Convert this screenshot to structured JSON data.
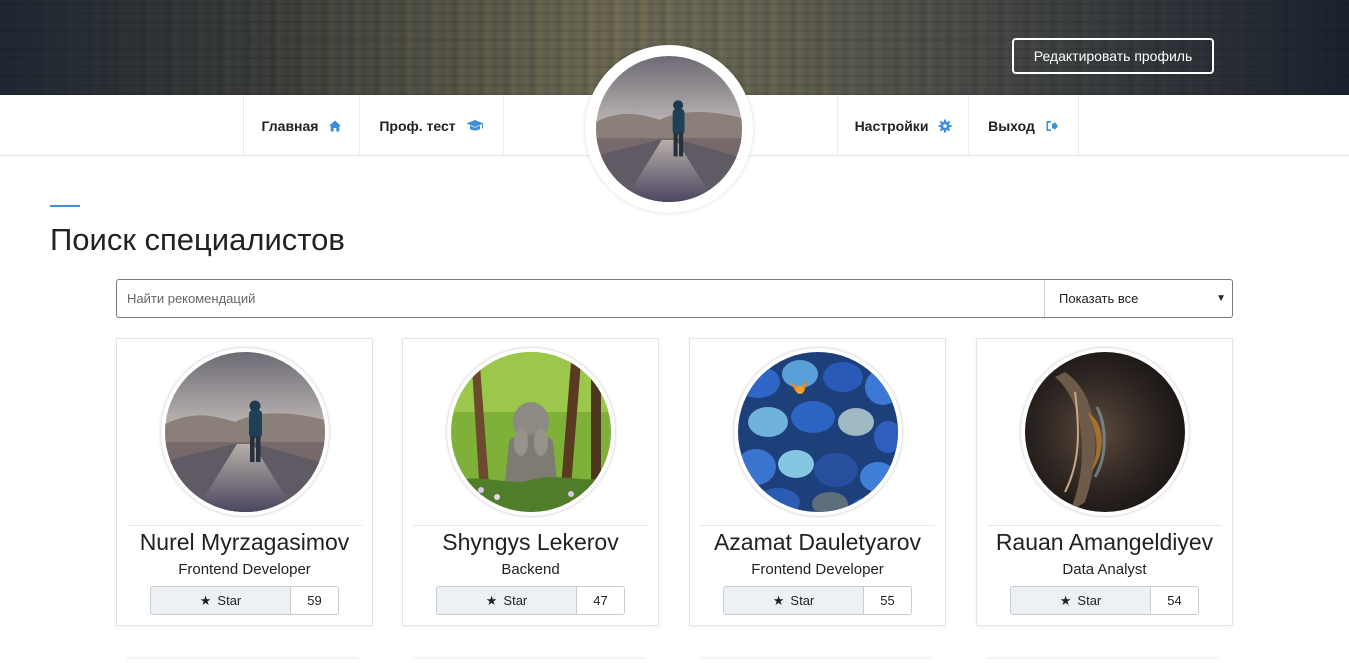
{
  "header": {
    "edit_profile_label": "Редактировать профиль"
  },
  "nav": {
    "items": [
      {
        "label": "Главная",
        "icon": "home-icon"
      },
      {
        "label": "Проф. тест",
        "icon": "graduation-cap-icon"
      },
      {
        "label": "Настройки",
        "icon": "gear-icon"
      },
      {
        "label": "Выход",
        "icon": "sign-out-icon"
      }
    ]
  },
  "profile": {
    "avatar": "road-walker-photo"
  },
  "page": {
    "title": "Поиск специалистов"
  },
  "search": {
    "placeholder": "Найти рекомендаций",
    "value": "",
    "filter_selected": "Показать все"
  },
  "colors": {
    "accent": "#3d8fd6",
    "star_button_bg": "#eef1f4"
  },
  "specialists": [
    {
      "name": "Nurel Myrzagasimov",
      "role": "Frontend Developer",
      "star_label": "Star",
      "stars": "59",
      "photo": "road-walker-photo"
    },
    {
      "name": "Shyngys Lekerov",
      "role": "Backend",
      "star_label": "Star",
      "stars": "47",
      "photo": "stone-statue-photo"
    },
    {
      "name": "Azamat Dauletyarov",
      "role": "Frontend Developer",
      "star_label": "Star",
      "stars": "55",
      "photo": "blue-pebbles-butterfly-photo"
    },
    {
      "name": "Rauan Amangeldiyev",
      "role": "Data Analyst",
      "star_label": "Star",
      "stars": "54",
      "photo": "eye-closeup-photo"
    }
  ]
}
